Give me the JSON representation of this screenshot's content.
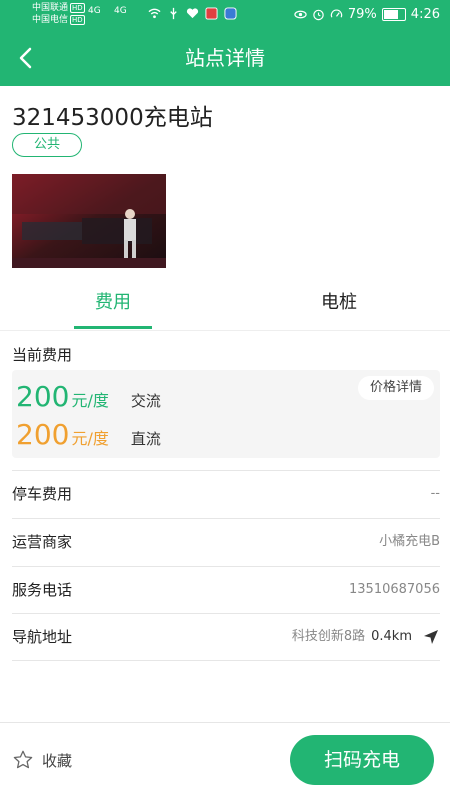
{
  "status_bar": {
    "carrier1": "中国联通",
    "carrier2": "中国电信",
    "hd": "HD",
    "signal": "4G",
    "battery": "79%",
    "battery_level": 0.79,
    "time": "4:26"
  },
  "header": {
    "title": "站点详情"
  },
  "station": {
    "name": "321453000充电站",
    "badge": "公共"
  },
  "tabs": [
    {
      "label": "费用",
      "active": true
    },
    {
      "label": "电桩",
      "active": false
    }
  ],
  "fees": {
    "section_title": "当前费用",
    "price_detail_label": "价格详情",
    "ac": {
      "price": "200",
      "unit": "元/度",
      "type": "交流",
      "color": "#22b573"
    },
    "dc": {
      "price": "200",
      "unit": "元/度",
      "type": "直流",
      "color": "#f0a030"
    }
  },
  "info_rows": [
    {
      "label": "停车费用",
      "value": "--"
    },
    {
      "label": "运营商家",
      "value": "小橘充电B"
    },
    {
      "label": "服务电话",
      "value": "13510687056"
    },
    {
      "label": "导航地址",
      "value": "科技创新8路",
      "distance": "0.4km",
      "icon": "navigation-arrow-icon"
    }
  ],
  "bottom_bar": {
    "favorite_label": "收藏",
    "favorite_icon": "star-icon",
    "scan_label": "扫码充电"
  },
  "colors": {
    "accent": "#22b573",
    "orange": "#f0a030"
  }
}
